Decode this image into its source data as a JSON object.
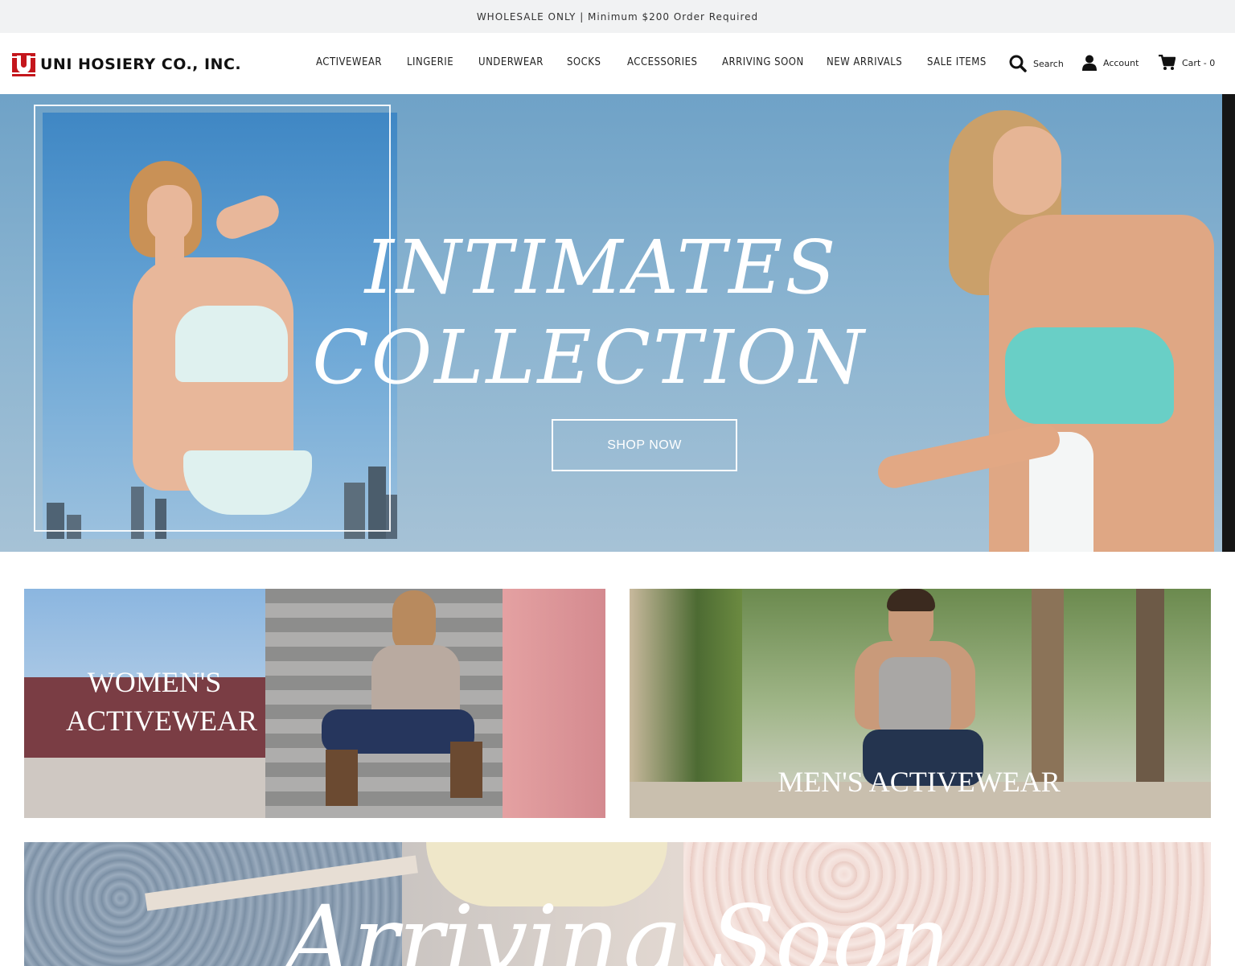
{
  "announcement": "WHOLESALE ONLY | Minimum $200 Order Required",
  "brand": {
    "name": "UNI HOSIERY CO., INC.",
    "accent": "#c4161c"
  },
  "nav": [
    "ACTIVEWEAR",
    "LINGERIE",
    "UNDERWEAR",
    "SOCKS",
    "ACCESSORIES",
    "ARRIVING SOON",
    "NEW ARRIVALS",
    "SALE ITEMS"
  ],
  "utilities": {
    "search": {
      "label": "Search",
      "icon": "search-icon"
    },
    "account": {
      "label": "Account",
      "icon": "user-icon"
    },
    "cart": {
      "label": "Cart - 0",
      "icon": "cart-icon"
    }
  },
  "hero": {
    "title_line1": "INTIMATES",
    "title_line2": "COLLECTION",
    "cta": "SHOP NOW"
  },
  "tiles": {
    "womens": {
      "line1": "WOMEN'S",
      "line2": "ACTIVEWEAR"
    },
    "mens": {
      "title": "MEN'S ACTIVEWEAR"
    }
  },
  "arriving": {
    "title": "Arriving Soon"
  }
}
